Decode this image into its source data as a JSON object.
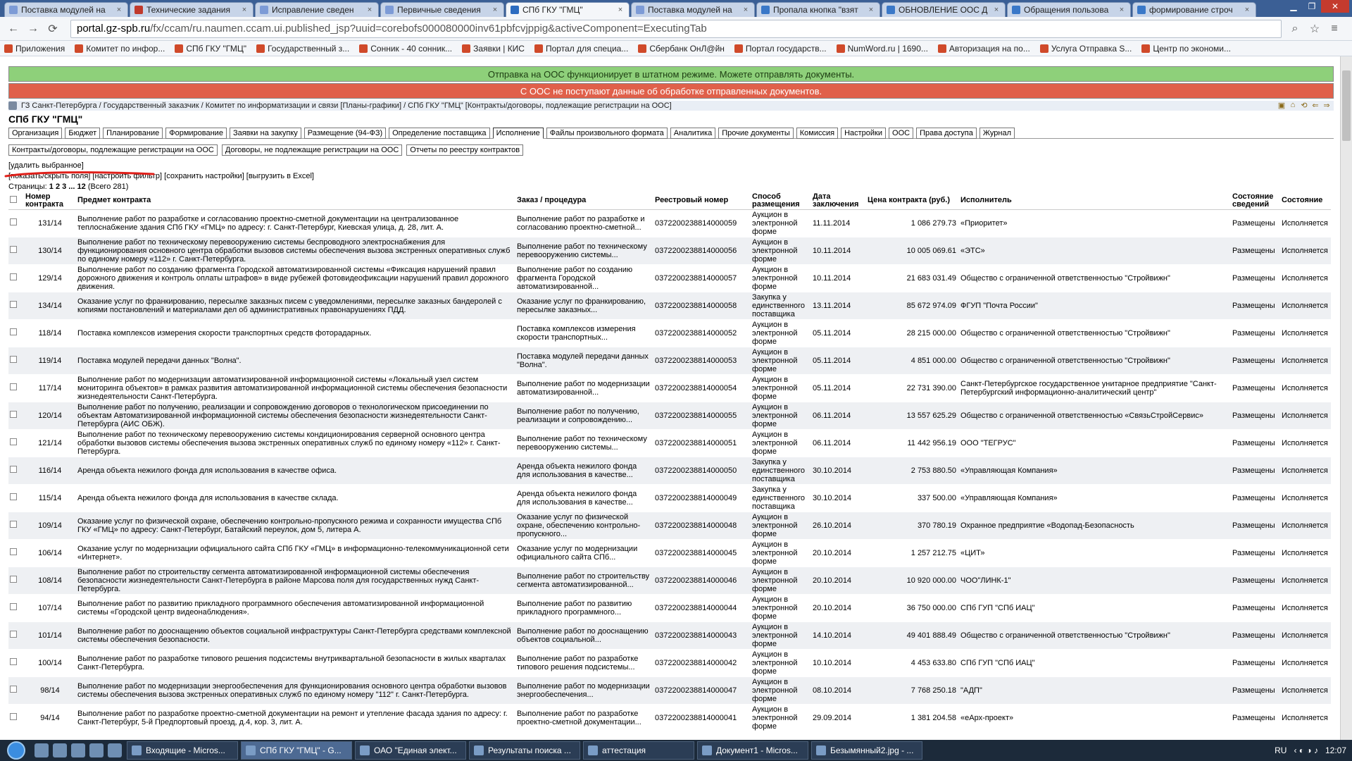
{
  "browser": {
    "tabs": [
      {
        "title": "Поставка модулей на"
      },
      {
        "title": "Технические задания"
      },
      {
        "title": "Исправление сведен"
      },
      {
        "title": "Первичные сведения"
      },
      {
        "title": "СПб ГКУ \"ГМЦ\"",
        "active": true
      },
      {
        "title": "Поставка модулей на"
      },
      {
        "title": "Пропала кнопка \"взят"
      },
      {
        "title": "ОБНОВЛЕНИЕ ООС Д"
      },
      {
        "title": "Обращения пользова"
      },
      {
        "title": "формирование строч"
      }
    ],
    "url_host": "portal.gz-spb.ru",
    "url_rest": "/fx/ccam/ru.naumen.ccam.ui.published_jsp?uuid=corebofs000080000inv61pbfcvjppig&activeComponent=ExecutingTab",
    "bookmarks": [
      "Приложения",
      "Комитет по инфор...",
      "СПб ГКУ \"ГМЦ\"",
      "Государственный з...",
      "Сонник - 40 сонник...",
      "Заявки | КИС",
      "Портал для специа...",
      "Сбербанк ОнЛ@йн",
      "Портал государств...",
      "NumWord.ru | 1690...",
      "Авторизация на по...",
      "Услуга Отправка S...",
      "Центр по экономи..."
    ]
  },
  "banners": {
    "ok": "Отправка на ООС функционирует в штатном режиме. Можете отправлять документы.",
    "error": "С ООС не поступают данные об обработке отправленных документов."
  },
  "breadcrumb": "ГЗ Санкт-Петербурга / Государственный заказчик / Комитет по информатизации и связи [Планы-графики] / СПб ГКУ \"ГМЦ\" [Контракты/договоры, подлежащие регистрации на ООС]",
  "org_title": "СПб ГКУ \"ГМЦ\"",
  "menu": [
    "Организация",
    "Бюджет",
    "Планирование",
    "Формирование",
    "Заявки на закупку",
    "Размещение (94-ФЗ)",
    "Определение поставщика",
    "Исполнение",
    "Файлы произвольного формата",
    "Аналитика",
    "Прочие документы",
    "Комиссия",
    "Настройки",
    "ООС",
    "Права доступа",
    "Журнал"
  ],
  "menu_selected": 7,
  "submenu": [
    "Контракты/договоры, подлежащие регистрации на ООС",
    "Договоры, не подлежащие регистрации на ООС",
    "Отчеты по реестру контрактов"
  ],
  "actions": {
    "delete_selected": "[удалить выбранное]",
    "toolbar": "[показать/скрыть поля] [настроить фильтр] [сохранить настройки] [выгрузить в Excel]",
    "pages_label": "Страницы:",
    "pages_links": "1 2 3 ... 12",
    "pages_total": "(Всего 281)"
  },
  "colors": {
    "ok_banner": "#8ed07a",
    "error_banner": "#e0604a",
    "annotation": "#e0201a"
  },
  "table": {
    "headers": [
      "",
      "Номер контракта",
      "Предмет контракта",
      "Заказ / процедура",
      "Реестровый номер",
      "Способ размещения",
      "Дата заключения",
      "Цена контракта (руб.)",
      "Исполнитель",
      "Состояние сведений",
      "Состояние"
    ],
    "rows": [
      [
        "131/14",
        "Выполнение работ по разработке и согласованию проектно-сметной документации на централизованное теплоснабжение здания СПб ГКУ «ГМЦ» по адресу: г. Санкт-Петербург, Киевская улица, д. 28, лит. А.",
        "Выполнение работ по разработке и согласованию проектно-сметной...",
        "0372200238814000059",
        "Аукцион в электронной форме",
        "11.11.2014",
        "1 086 279.73",
        "«Приоритет»",
        "Размещены",
        "Исполняется"
      ],
      [
        "130/14",
        "Выполнение работ по техническому перевооружению системы беспроводного электроснабжения для функционирования основного центра обработки вызовов системы обеспечения вызова экстренных оперативных служб по единому номеру «112» г. Санкт-Петербурга.",
        "Выполнение работ по техническому перевооружению системы...",
        "0372200238814000056",
        "Аукцион в электронной форме",
        "10.11.2014",
        "10 005 069.61",
        "«ЭТС»",
        "Размещены",
        "Исполняется"
      ],
      [
        "129/14",
        "Выполнение работ по созданию фрагмента Городской автоматизированной системы «Фиксация нарушений правил дорожного движения и контроль оплаты штрафов» в виде рубежей фотовидеофиксации нарушений правил дорожного движения.",
        "Выполнение работ по созданию фрагмента Городской автоматизированной...",
        "0372200238814000057",
        "Аукцион в электронной форме",
        "10.11.2014",
        "21 683 031.49",
        "Общество с ограниченной ответственностью \"Стройвижн\"",
        "Размещены",
        "Исполняется"
      ],
      [
        "134/14",
        "Оказание услуг по франкированию, пересылке заказных писем с уведомлениями, пересылке заказных бандеролей с копиями постановлений и материалами дел об административных правонарушениях ПДД.",
        "Оказание услуг по франкированию, пересылке заказных...",
        "0372200238814000058",
        "Закупка у единственного поставщика",
        "13.11.2014",
        "85 672 974.09",
        "ФГУП \"Почта России\"",
        "Размещены",
        "Исполняется"
      ],
      [
        "118/14",
        "Поставка комплексов измерения скорости транспортных средств фоторадарных.",
        "Поставка комплексов измерения скорости транспортных...",
        "0372200238814000052",
        "Аукцион в электронной форме",
        "05.11.2014",
        "28 215 000.00",
        "Общество с ограниченной ответственностью \"Стройвижн\"",
        "Размещены",
        "Исполняется"
      ],
      [
        "119/14",
        "Поставка модулей передачи данных \"Волна\".",
        "Поставка модулей передачи данных \"Волна\".",
        "0372200238814000053",
        "Аукцион в электронной форме",
        "05.11.2014",
        "4 851 000.00",
        "Общество с ограниченной ответственностью \"Стройвижн\"",
        "Размещены",
        "Исполняется"
      ],
      [
        "117/14",
        "Выполнение работ по модернизации автоматизированной информационной системы «Локальный узел систем мониторинга объектов» в рамках развития автоматизированной информационной системы обеспечения безопасности жизнедеятельности Санкт-Петербурга.",
        "Выполнение работ по модернизации автоматизированной...",
        "0372200238814000054",
        "Аукцион в электронной форме",
        "05.11.2014",
        "22 731 390.00",
        "Санкт-Петербургское государственное унитарное предприятие \"Санкт-Петербургский информационно-аналитический центр\"",
        "Размещены",
        "Исполняется"
      ],
      [
        "120/14",
        "Выполнение работ по получению, реализации и сопровождению договоров о технологическом присоединении по объектам Автоматизированной информационной системы обеспечения безопасности жизнедеятельности Санкт-Петербурга (АИС ОБЖ).",
        "Выполнение работ по получению, реализации и сопровождению...",
        "0372200238814000055",
        "Аукцион в электронной форме",
        "06.11.2014",
        "13 557 625.29",
        "Общество с ограниченной ответственностью «СвязьСтройСервис»",
        "Размещены",
        "Исполняется"
      ],
      [
        "121/14",
        "Выполнение работ по техническому перевооружению системы кондиционирования серверной основного центра обработки вызовов системы обеспечения вызова экстренных оперативных служб по единому номеру «112» г. Санкт-Петербурга.",
        "Выполнение работ по техническому перевооружению системы...",
        "0372200238814000051",
        "Аукцион в электронной форме",
        "06.11.2014",
        "11 442 956.19",
        "ООО \"ТЕГРУС\"",
        "Размещены",
        "Исполняется"
      ],
      [
        "116/14",
        "Аренда объекта нежилого фонда для использования в качестве офиса.",
        "Аренда объекта нежилого фонда для использования в качестве...",
        "0372200238814000050",
        "Закупка у единственного поставщика",
        "30.10.2014",
        "2 753 880.50",
        "«Управляющая Компания»",
        "Размещены",
        "Исполняется"
      ],
      [
        "115/14",
        "Аренда объекта нежилого фонда для использования в качестве склада.",
        "Аренда объекта нежилого фонда для использования в качестве...",
        "0372200238814000049",
        "Закупка у единственного поставщика",
        "30.10.2014",
        "337 500.00",
        "«Управляющая Компания»",
        "Размещены",
        "Исполняется"
      ],
      [
        "109/14",
        "Оказание услуг по физической охране, обеспечению контрольно-пропускного режима и сохранности имущества СПб ГКУ «ГМЦ» по адресу: Санкт-Петербург, Батайский переулок, дом 5, литера А.",
        "Оказание услуг по физической охране, обеспечению контрольно-пропускного...",
        "0372200238814000048",
        "Аукцион в электронной форме",
        "26.10.2014",
        "370 780.19",
        "Охранное предприятие «Водопад-Безопасность",
        "Размещены",
        "Исполняется"
      ],
      [
        "106/14",
        "Оказание услуг по модернизации официального сайта СПб ГКУ «ГМЦ» в информационно-телекоммуникационной сети «Интернет».",
        "Оказание услуг по модернизации официального сайта СПб...",
        "0372200238814000045",
        "Аукцион в электронной форме",
        "20.10.2014",
        "1 257 212.75",
        "«ЦИТ»",
        "Размещены",
        "Исполняется"
      ],
      [
        "108/14",
        "Выполнение работ по строительству сегмента автоматизированной информационной системы обеспечения безопасности жизнедеятельности Санкт-Петербурга в районе Марсова поля для государственных нужд Санкт-Петербурга.",
        "Выполнение работ по строительству сегмента автоматизированной...",
        "0372200238814000046",
        "Аукцион в электронной форме",
        "20.10.2014",
        "10 920 000.00",
        "ЧОО\"ЛИНК-1\"",
        "Размещены",
        "Исполняется"
      ],
      [
        "107/14",
        "Выполнение работ по развитию прикладного программного обеспечения автоматизированной информационной системы «Городской центр видеонаблюдения».",
        "Выполнение работ по развитию прикладного программного...",
        "0372200238814000044",
        "Аукцион в электронной форме",
        "20.10.2014",
        "36 750 000.00",
        "СПб ГУП \"СПб ИАЦ\"",
        "Размещены",
        "Исполняется"
      ],
      [
        "101/14",
        "Выполнение работ по дооснащению объектов социальной инфраструктуры Санкт-Петербурга средствами комплексной системы обеспечения безопасности.",
        "Выполнение работ по дооснащению объектов социальной...",
        "0372200238814000043",
        "Аукцион в электронной форме",
        "14.10.2014",
        "49 401 888.49",
        "Общество с ограниченной ответственностью \"Стройвижн\"",
        "Размещены",
        "Исполняется"
      ],
      [
        "100/14",
        "Выполнение работ по разработке типового решения подсистемы внутриквартальной безопасности в жилых кварталах Санкт-Петербурга.",
        "Выполнение работ по разработке типового решения подсистемы...",
        "0372200238814000042",
        "Аукцион в электронной форме",
        "10.10.2014",
        "4 453 633.80",
        "СПб ГУП \"СПб ИАЦ\"",
        "Размещены",
        "Исполняется"
      ],
      [
        "98/14",
        "Выполнение работ по модернизации энергообеспечения для функционирования основного центра обработки вызовов системы обеспечения вызова экстренных оперативных служб по единому номеру \"112\" г. Санкт-Петербурга.",
        "Выполнение работ по модернизации энергообеспечения...",
        "0372200238814000047",
        "Аукцион в электронной форме",
        "08.10.2014",
        "7 768 250.18",
        "\"АДП\"",
        "Размещены",
        "Исполняется"
      ],
      [
        "94/14",
        "Выполнение работ по разработке проектно-сметной документации на ремонт и утепление фасада здания по адресу: г. Санкт-Петербург, 5-й Предпортовый проезд, д.4, кор. 3, лит. А.",
        "Выполнение работ по разработке проектно-сметной документации...",
        "0372200238814000041",
        "Аукцион в электронной форме",
        "29.09.2014",
        "1 381 204.58",
        "«еАрх-проект»",
        "Размещены",
        "Исполняется"
      ]
    ]
  },
  "taskbar": {
    "items": [
      "Входящие - Micros...",
      "СПб ГКУ \"ГМЦ\" - G...",
      "ОАО \"Единая элект...",
      "Результаты поиска ...",
      "аттестация",
      "Документ1 - Micros...",
      "Безымянный2.jpg - ..."
    ],
    "active": 1,
    "lang": "RU",
    "clock": "12:07"
  }
}
